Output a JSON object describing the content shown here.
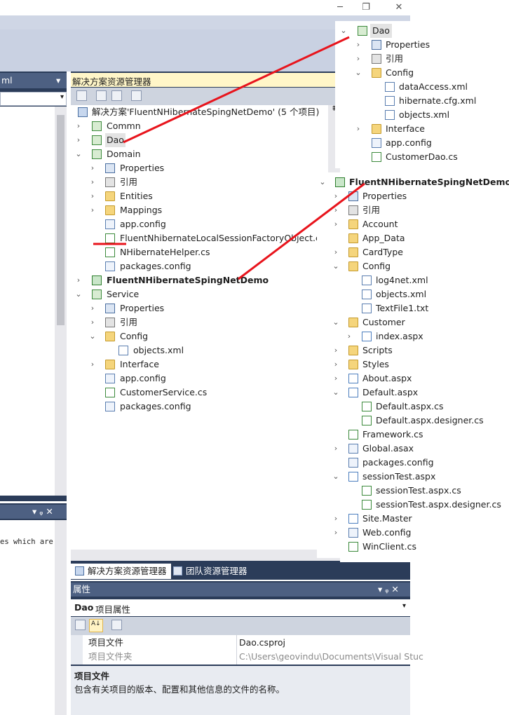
{
  "window": {
    "restore_glyph": "❐",
    "close_glyph": "✕"
  },
  "left_panel": {
    "header_text": "ml",
    "header_dropdown_glyph": "▾",
    "output_header_pin": "▾ ᵩ ✕",
    "code_snippet": "es which are"
  },
  "solution_explorer": {
    "header_title": "解决方案资源管理器",
    "solution_label": "解决方案'FluentNHibernateSpingNetDemo' (5 个项目)",
    "items": [
      {
        "label": "Commn"
      },
      {
        "label": "Dao"
      },
      {
        "label": "Domain"
      },
      {
        "label": "Properties"
      },
      {
        "label": "引用"
      },
      {
        "label": "Entities"
      },
      {
        "label": "Mappings"
      },
      {
        "label": "app.config"
      },
      {
        "label": "FluentNhibernateLocalSessionFactoryObject.cs"
      },
      {
        "label": "NHibernateHelper.cs"
      },
      {
        "label": "packages.config"
      },
      {
        "label": "FluentNHibernateSpingNetDemo"
      },
      {
        "label": "Service"
      },
      {
        "label": "Properties"
      },
      {
        "label": "引用"
      },
      {
        "label": "Config"
      },
      {
        "label": "objects.xml"
      },
      {
        "label": "Interface"
      },
      {
        "label": "app.config"
      },
      {
        "label": "CustomerService.cs"
      },
      {
        "label": "packages.config"
      }
    ],
    "tabs": [
      "解决方案资源管理器",
      "团队资源管理器"
    ]
  },
  "dao_overlay": {
    "items": [
      {
        "label": "Dao"
      },
      {
        "label": "Properties"
      },
      {
        "label": "引用"
      },
      {
        "label": "Config"
      },
      {
        "label": "dataAccess.xml"
      },
      {
        "label": "hibernate.cfg.xml"
      },
      {
        "label": "objects.xml"
      },
      {
        "label": "Interface"
      },
      {
        "label": "app.config"
      },
      {
        "label": "CustomerDao.cs"
      }
    ]
  },
  "web_overlay": {
    "items": [
      {
        "label": "FluentNHibernateSpingNetDemo"
      },
      {
        "label": "Properties"
      },
      {
        "label": "引用"
      },
      {
        "label": "Account"
      },
      {
        "label": "App_Data"
      },
      {
        "label": "CardType"
      },
      {
        "label": "Config"
      },
      {
        "label": "log4net.xml"
      },
      {
        "label": "objects.xml"
      },
      {
        "label": "TextFile1.txt"
      },
      {
        "label": "Customer"
      },
      {
        "label": "index.aspx"
      },
      {
        "label": "Scripts"
      },
      {
        "label": "Styles"
      },
      {
        "label": "About.aspx"
      },
      {
        "label": "Default.aspx"
      },
      {
        "label": "Default.aspx.cs"
      },
      {
        "label": "Default.aspx.designer.cs"
      },
      {
        "label": "Framework.cs"
      },
      {
        "label": "Global.asax"
      },
      {
        "label": "packages.config"
      },
      {
        "label": "sessionTest.aspx"
      },
      {
        "label": "sessionTest.aspx.cs"
      },
      {
        "label": "sessionTest.aspx.designer.cs"
      },
      {
        "label": "Site.Master"
      },
      {
        "label": "Web.config"
      },
      {
        "label": "WinClient.cs"
      }
    ]
  },
  "properties": {
    "header_title": "属性",
    "header_buttons": "▾ ᵩ ✕",
    "object_name": "Dao",
    "object_type": "项目属性",
    "rows": [
      {
        "name": "项目文件",
        "value": "Dao.csproj"
      },
      {
        "name": "项目文件夹",
        "value": "C:\\Users\\geovindu\\Documents\\Visual Stuc"
      }
    ],
    "desc_title": "项目文件",
    "desc_text": "包含有关项目的版本、配置和其他信息的文件的名称。"
  },
  "colors": {
    "panel_dark": "#2b3c59",
    "header_highlight": "#fff6c8",
    "annotation_red": "#e8141c"
  }
}
